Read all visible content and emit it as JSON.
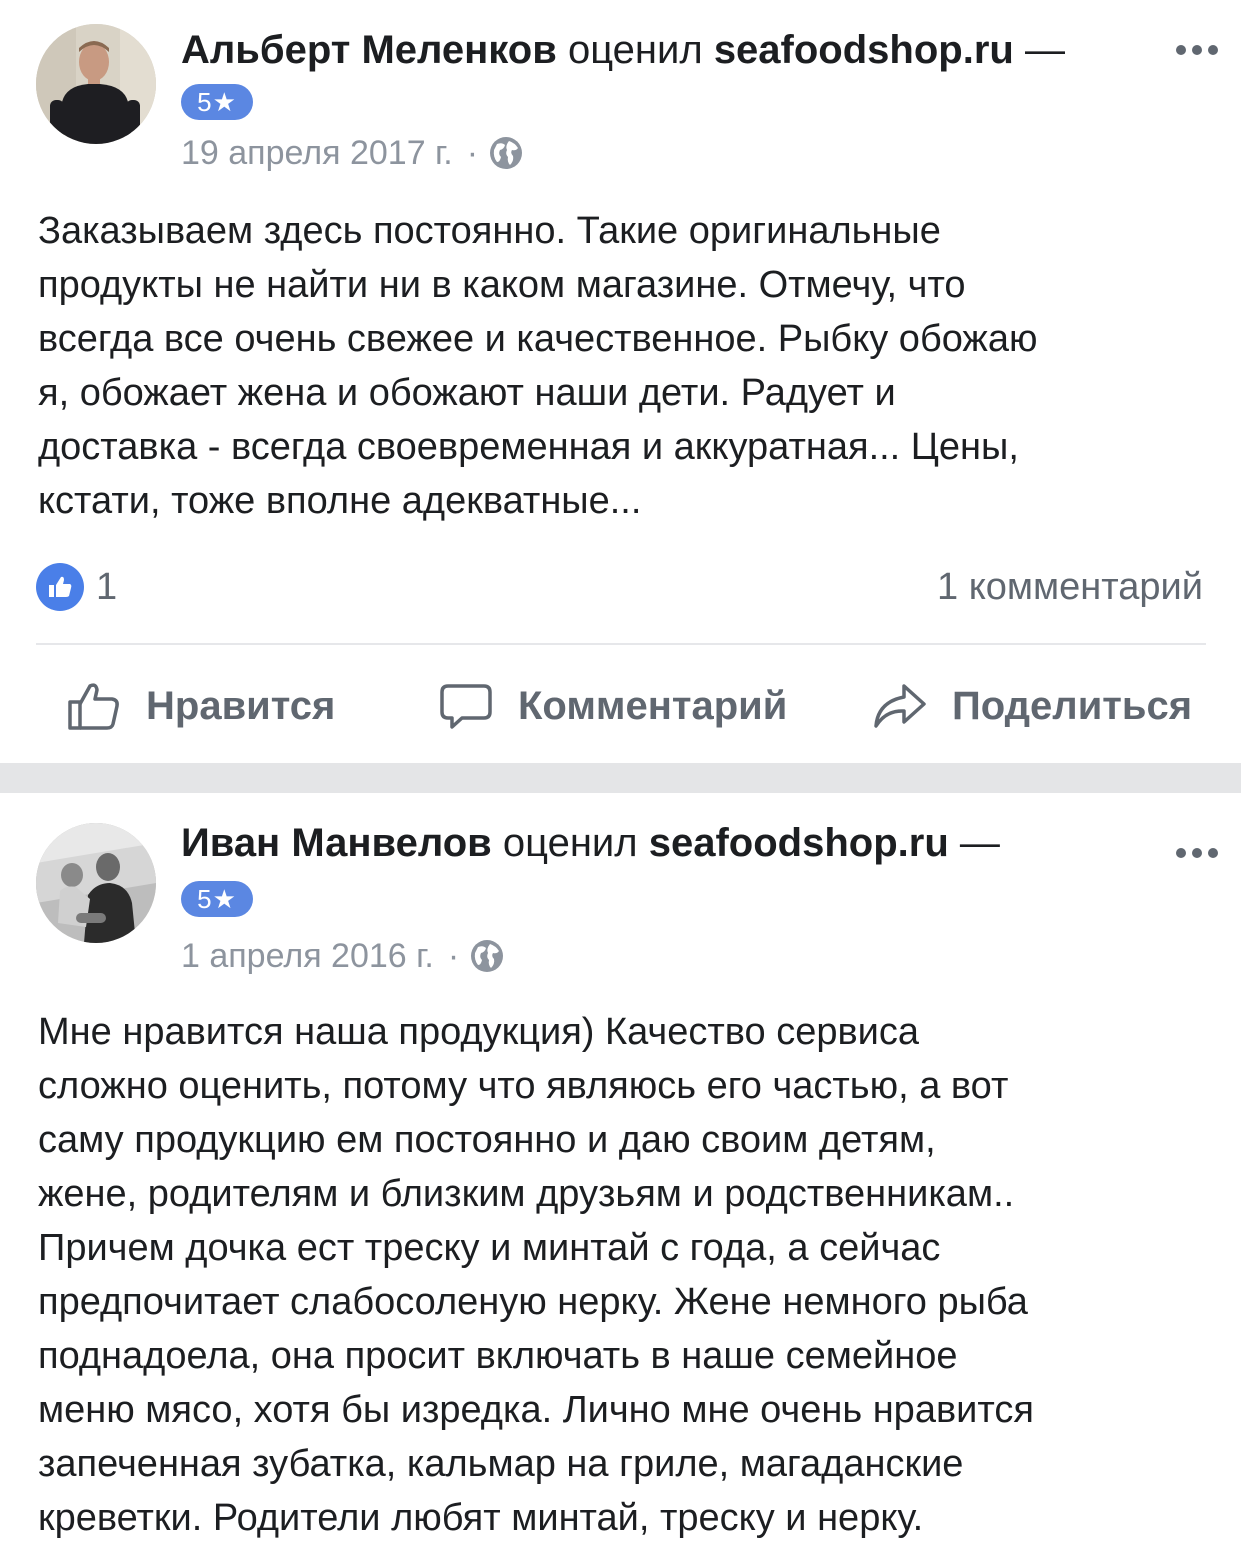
{
  "posts": [
    {
      "author": "Альберт Меленков",
      "verb": "оценил",
      "page": "seafoodshop.ru",
      "dash": "—",
      "rating": "5★",
      "date": "19 апреля 2017 г.",
      "dot": "·",
      "privacy_icon": "globe-icon",
      "text": "Заказываем здесь постоянно. Такие оригинальные\nпродукты не найти ни в каком магазине. Отмечу, что\nвсегда все очень свежее и качественное. Рыбку обожаю\nя, обожает жена и обожают наши дети. Радует и\nдоставка - всегда своевременная и аккуратная... Цены,\nкстати, тоже вполне адекватные...",
      "likes": "1",
      "comments": "1 комментарий"
    },
    {
      "author": "Иван Манвелов",
      "verb": "оценил",
      "page": "seafoodshop.ru",
      "dash": "—",
      "rating": "5★",
      "date": "1 апреля 2016 г.",
      "dot": "·",
      "privacy_icon": "globe-icon",
      "text": "Мне нравится наша продукция) Качество сервиса\nсложно оценить, потому что являюсь его частью, а вот\nсаму продукцию ем постоянно и даю своим детям,\nжене,  родителям и близким друзьям и родственникам..\nПричем дочка ест треску и  минтай с года, а сейчас\nпредпочитает слабосоленую нерку. Жене немного рыба\nподнадоела, она просит включать в наше семейное\nменю мясо, хотя бы изредка. Лично мне очень нравится\nзапеченная зубатка, кальмар на гриле, магаданские\nкреветки. Родители любят минтай, треску и нерку."
    }
  ],
  "actions": {
    "like": "Нравится",
    "comment": "Комментарий",
    "share": "Поделиться"
  },
  "colors": {
    "badge": "#5b87e2",
    "like_bubble": "#4a7fe8",
    "muted_text": "#8d949e",
    "action_text": "#606770",
    "separator": "#e4e5e7"
  }
}
